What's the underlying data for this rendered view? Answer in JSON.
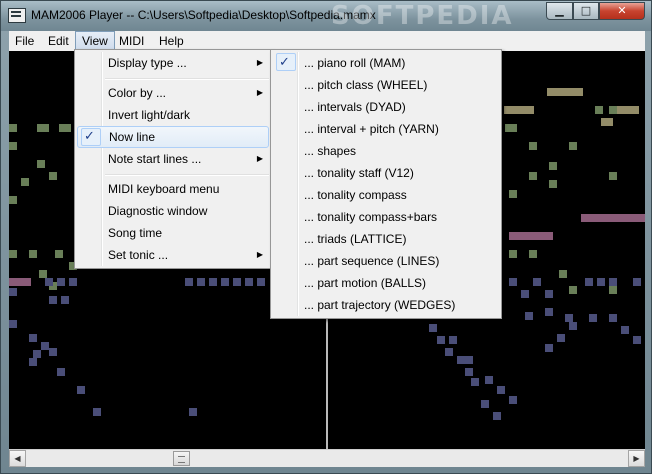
{
  "window": {
    "title": "MAM2006 Player -- C:\\Users\\Softpedia\\Desktop\\Softpedia.mamx",
    "watermark": "SOFTPEDIA",
    "min_glyph": "▁",
    "max_glyph": "□",
    "close_glyph": "✕"
  },
  "menubar": {
    "items": [
      "File",
      "Edit",
      "View",
      "MIDI",
      "Help"
    ]
  },
  "view_menu": {
    "items": [
      {
        "label": "Display type ..."
      },
      {
        "label": "Color by ..."
      },
      {
        "label": "Invert light/dark"
      },
      {
        "label": "Now line"
      },
      {
        "label": "Note start lines ..."
      },
      {
        "label": "MIDI keyboard menu"
      },
      {
        "label": "Diagnostic window"
      },
      {
        "label": "Song time"
      },
      {
        "label": "Set tonic ..."
      }
    ],
    "checked_item": "Now line"
  },
  "display_submenu": {
    "items": [
      {
        "label": "... piano roll (MAM)"
      },
      {
        "label": "... pitch class (WHEEL)"
      },
      {
        "label": "... intervals (DYAD)"
      },
      {
        "label": "... interval + pitch (YARN)"
      },
      {
        "label": "... shapes"
      },
      {
        "label": "... tonality staff (V12)"
      },
      {
        "label": "... tonality compass"
      },
      {
        "label": "... tonality compass+bars"
      },
      {
        "label": "... triads (LATTICE)"
      },
      {
        "label": "... part sequence (LINES)"
      },
      {
        "label": "... part motion (BALLS)"
      },
      {
        "label": "... part trajectory (WEDGES)"
      }
    ],
    "checked_item": "... piano roll (MAM)"
  },
  "icons": {
    "check": "✓",
    "submenu_arrow": "▶",
    "scroll_left": "◀",
    "scroll_right": "▶"
  },
  "colors": {
    "background": "#000000",
    "note_tan": "#938c68",
    "note_green": "#697f58",
    "note_mauve": "#8a5b78",
    "note_blue": "#4a4e78",
    "now_line": "#b9b9b9"
  }
}
